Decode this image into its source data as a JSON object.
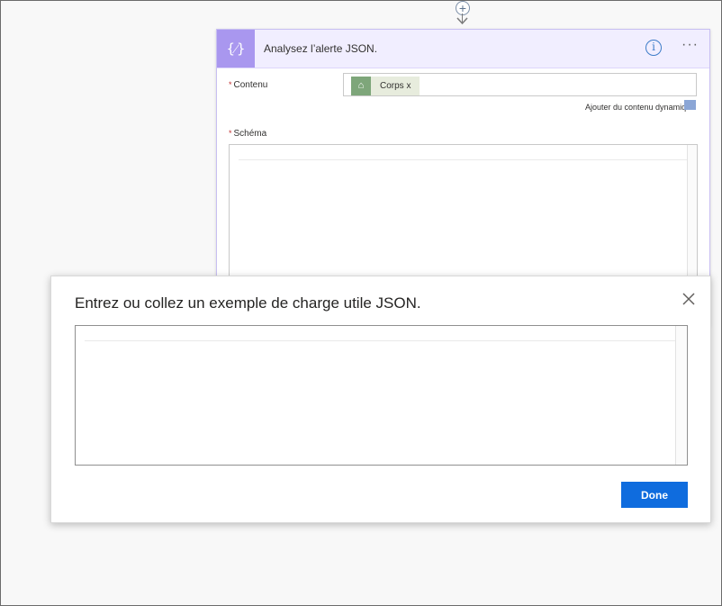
{
  "flow": {
    "add_step_glyph": "+"
  },
  "action_card": {
    "icon_glyph": "{⁄}",
    "title": "Analysez l’alerte JSON.",
    "info_glyph": "i",
    "more_glyph": "···",
    "accent_color": "#a997ef",
    "content_field": {
      "required_mark": "*",
      "label": "Contenu",
      "token": {
        "icon_glyph": "⌂",
        "label": "Corps x"
      }
    },
    "dynamic_content_link": "Ajouter du contenu dynamique",
    "schema_field": {
      "required_mark": "*",
      "label": "Schéma"
    }
  },
  "dialog": {
    "title": "Entrez ou collez un exemple de charge utile JSON.",
    "payload_value": "",
    "done_label": "Done",
    "done_color": "#0f6cde"
  }
}
